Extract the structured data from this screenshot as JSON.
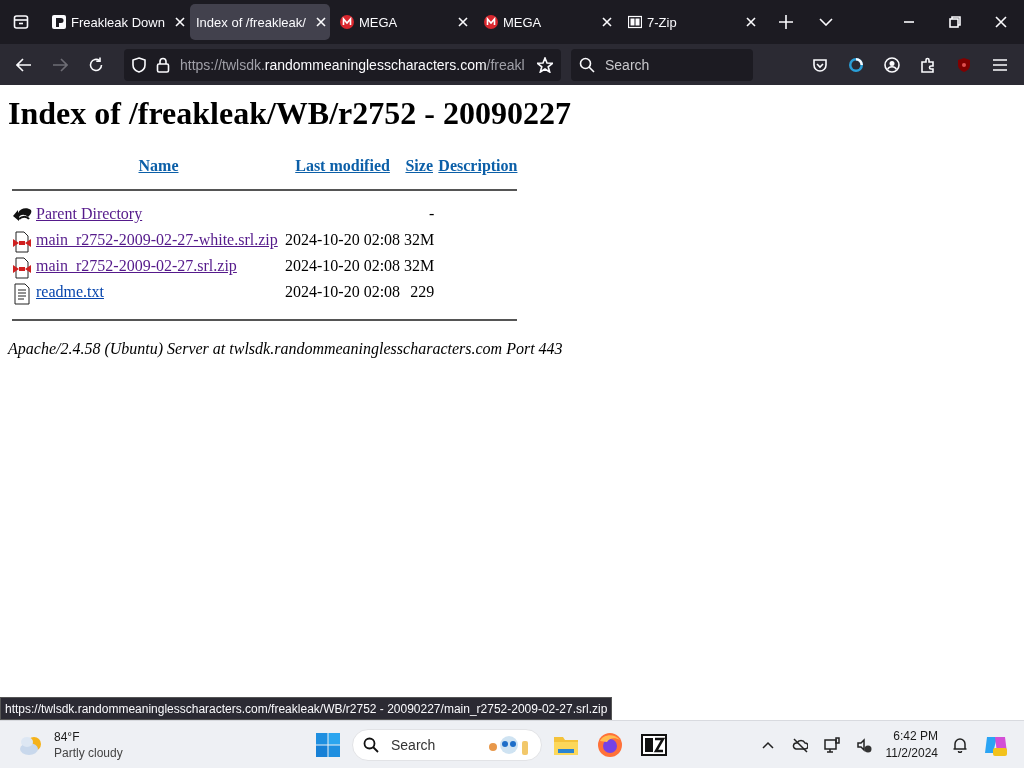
{
  "tabs": [
    {
      "title": "Freakleak Down",
      "selected": false
    },
    {
      "title": "Index of /freakleak/",
      "selected": true
    },
    {
      "title": "MEGA",
      "selected": false
    },
    {
      "title": "MEGA",
      "selected": false
    },
    {
      "title": "7-Zip",
      "selected": false
    }
  ],
  "navigation": {
    "forward_disabled": true,
    "url_scheme": "https://twlsdk.",
    "url_domain": "randommeaninglesscharacters.com",
    "url_path": "/freakl",
    "search_placeholder": "Search"
  },
  "page": {
    "heading": "Index of /freakleak/WB/r2752 - 20090227",
    "columns": [
      "Name",
      "Last modified",
      "Size",
      "Description"
    ],
    "rows": [
      {
        "kind": "back",
        "name": "Parent Directory",
        "size": "-",
        "visited": true
      },
      {
        "kind": "archive",
        "name": "main_r2752-2009-02-27-white.srl.zip",
        "modified": "2024-10-20 02:08",
        "size": "32M",
        "visited": true
      },
      {
        "kind": "archive",
        "name": "main_r2752-2009-02-27.srl.zip",
        "modified": "2024-10-20 02:08",
        "size": "32M",
        "visited": true
      },
      {
        "kind": "text",
        "name": "readme.txt",
        "modified": "2024-10-20 02:08",
        "size": "229",
        "visited": false
      }
    ],
    "footer": "Apache/2.4.58 (Ubuntu) Server at twlsdk.randommeaninglesscharacters.com Port 443"
  },
  "status_url": "https://twlsdk.randommeaninglesscharacters.com/freakleak/WB/r2752 - 20090227/main_r2752-2009-02-27.srl.zip",
  "taskbar": {
    "temperature": "84°F",
    "condition": "Partly cloudy",
    "search_placeholder": "Search",
    "time": "6:42 PM",
    "date": "11/2/2024"
  }
}
